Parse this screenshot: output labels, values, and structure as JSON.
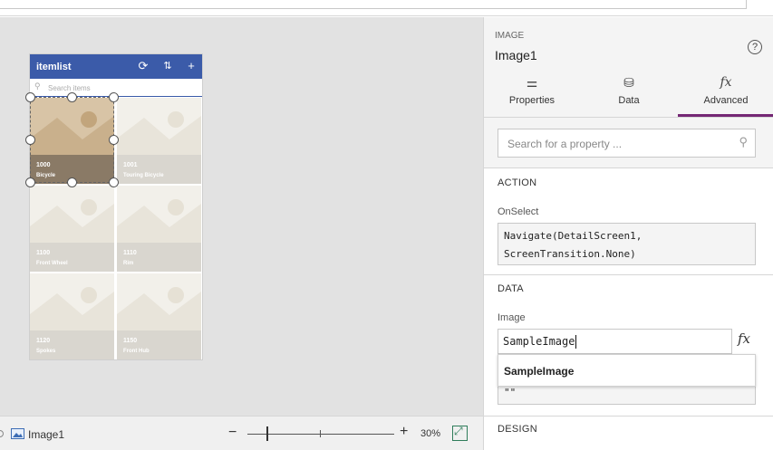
{
  "app": {
    "colors": {
      "accent": "#742774",
      "header_blue": "#3b5ba9",
      "canvas_bg": "#e2e2e2"
    }
  },
  "phone": {
    "title": "itemlist",
    "icons": [
      "refresh-icon",
      "sort-icon",
      "add-icon"
    ],
    "search_placeholder": "Search items",
    "tiles": [
      {
        "number": "1000",
        "name": "Bicycle",
        "selected": true
      },
      {
        "number": "1001",
        "name": "Touring Bicycle",
        "selected": false
      },
      {
        "number": "1100",
        "name": "Front Wheel",
        "selected": false
      },
      {
        "number": "1110",
        "name": "Rim",
        "selected": false
      },
      {
        "number": "1120",
        "name": "Spokes",
        "selected": false
      },
      {
        "number": "1150",
        "name": "Front Hub",
        "selected": false
      }
    ]
  },
  "statusbar": {
    "selected_control": "Image1",
    "zoom_minus": "−",
    "zoom_plus": "+",
    "zoom_level": "30%"
  },
  "panel": {
    "control_type": "IMAGE",
    "control_name": "Image1",
    "help": "?",
    "tabs": [
      {
        "label": "Properties",
        "icon": "sliders-icon",
        "glyph": "⚌"
      },
      {
        "label": "Data",
        "icon": "database-icon",
        "glyph": "⛁"
      },
      {
        "label": "Advanced",
        "icon": "fx-icon",
        "glyph": "fx",
        "active": true
      }
    ],
    "search_placeholder": "Search for a property ...",
    "action_section": "ACTION",
    "onselect_label": "OnSelect",
    "onselect_value_line1": "Navigate(DetailScreen1,",
    "onselect_value_line2": "ScreenTransition.None)",
    "data_section": "DATA",
    "image_label": "Image",
    "image_value": "SampleImage",
    "fx_label": "fx",
    "suggestion": "SampleImage",
    "behind_value": "\"\"",
    "design_section": "DESIGN"
  }
}
